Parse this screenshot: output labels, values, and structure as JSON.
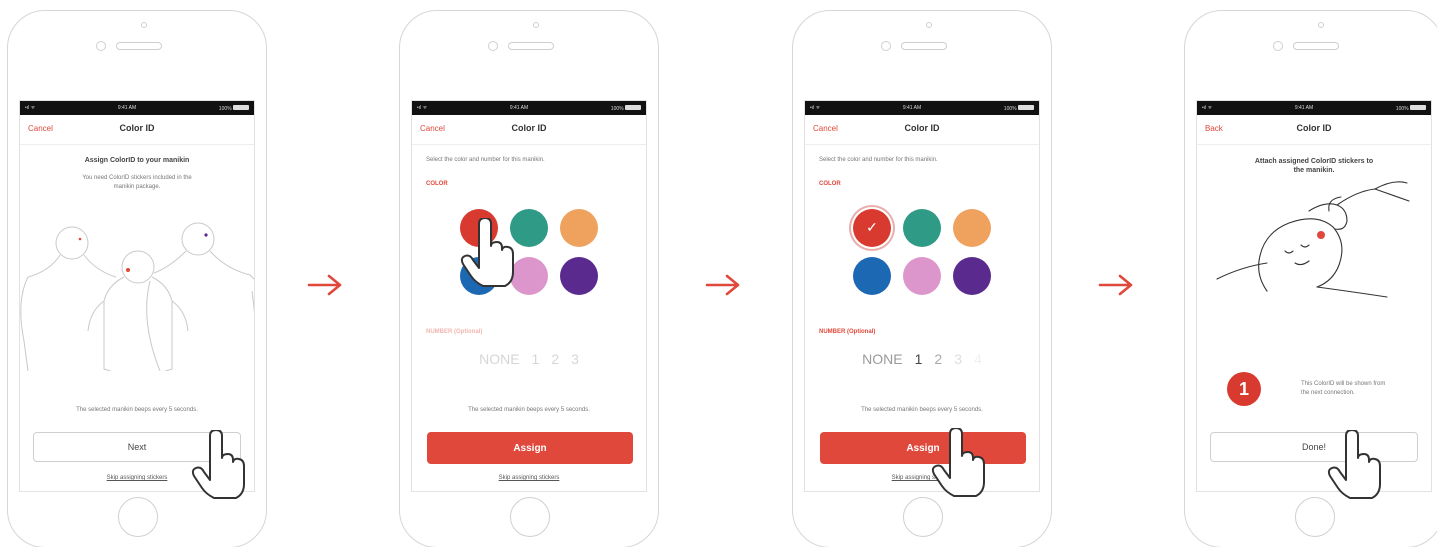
{
  "step1": {
    "status": {
      "signal": "•ıl ᯤ",
      "time": "9:41 AM",
      "battery": "100%"
    },
    "nav": {
      "left": "Cancel",
      "title": "Color ID"
    },
    "heading": "Assign ColorID to your manikin",
    "subtext": "You need ColorID stickers included in the manikin package.",
    "beep": "The selected manikin beeps every 5 seconds.",
    "button": "Next",
    "link": "Skip assigning stickers"
  },
  "step2": {
    "status": {
      "signal": "•ıl ᯤ",
      "time": "9:41 AM",
      "battery": "100%"
    },
    "nav": {
      "left": "Cancel",
      "title": "Color ID"
    },
    "instruction": "Select the color and number for this manikin.",
    "color_label": "COLOR",
    "number_label": "NUMBER (Optional)",
    "numbers": [
      "NONE",
      "1",
      "2",
      "3"
    ],
    "beep": "The selected manikin beeps every 5 seconds.",
    "button": "Assign",
    "link": "Skip assigning stickers"
  },
  "step3": {
    "status": {
      "signal": "•ıl ᯤ",
      "time": "9:41 AM",
      "battery": "100%"
    },
    "nav": {
      "left": "Cancel",
      "title": "Color ID"
    },
    "instruction": "Select the color and number for this manikin.",
    "color_label": "COLOR",
    "number_label": "NUMBER (Optional)",
    "numbers": [
      "NONE",
      "1",
      "2",
      "3",
      "4"
    ],
    "beep": "The selected manikin beeps every 5 seconds.",
    "button": "Assign",
    "link": "Skip assigning stickers"
  },
  "step4": {
    "status": {
      "signal": "•ıl ᯤ",
      "time": "9:41 AM",
      "battery": "100%"
    },
    "nav": {
      "left": "Back",
      "title": "Color ID"
    },
    "heading": "Attach assigned ColorID stickers to the manikin.",
    "badge_number": "1",
    "info": "This ColorID will be shown from the next connection.",
    "button": "Done!"
  },
  "colors": [
    "#d83a30",
    "#2f9a86",
    "#efa15e",
    "#1d68b3",
    "#dd96cc",
    "#5b2a8e"
  ],
  "accent": "#e0483b"
}
